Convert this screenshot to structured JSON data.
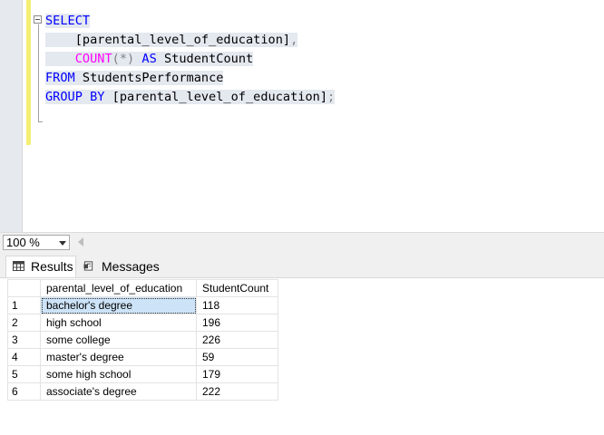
{
  "editor": {
    "lines": [
      [
        {
          "t": "SELECT",
          "c": "kw"
        }
      ],
      [
        {
          "t": "    [parental_level_of_education]",
          "c": "tx"
        },
        {
          "t": ",",
          "c": "gr"
        }
      ],
      [
        {
          "t": "    ",
          "c": "tx"
        },
        {
          "t": "COUNT",
          "c": "fn"
        },
        {
          "t": "(*)",
          "c": "gr"
        },
        {
          "t": " ",
          "c": "tx"
        },
        {
          "t": "AS",
          "c": "kw"
        },
        {
          "t": " StudentCount",
          "c": "tx"
        }
      ],
      [
        {
          "t": "FROM",
          "c": "kw"
        },
        {
          "t": " StudentsPerformance",
          "c": "tx"
        }
      ],
      [
        {
          "t": "GROUP BY",
          "c": "kw"
        },
        {
          "t": " [parental_level_of_education]",
          "c": "tx"
        },
        {
          "t": ";",
          "c": "gr"
        }
      ]
    ]
  },
  "zoom": {
    "value": "100 %"
  },
  "tabs": {
    "results": "Results",
    "messages": "Messages"
  },
  "grid": {
    "columns": [
      "parental_level_of_education",
      "StudentCount"
    ],
    "rows": [
      [
        "1",
        "bachelor's degree",
        "118"
      ],
      [
        "2",
        "high school",
        "196"
      ],
      [
        "3",
        "some college",
        "226"
      ],
      [
        "4",
        "master's degree",
        "59"
      ],
      [
        "5",
        "some high school",
        "179"
      ],
      [
        "6",
        "associate's degree",
        "222"
      ]
    ]
  },
  "colors": {
    "keyword": "#0000ff",
    "function": "#ff00ff",
    "operator": "#808080",
    "selection": "#e4e8ef",
    "active_cell": "#cde3f7"
  }
}
